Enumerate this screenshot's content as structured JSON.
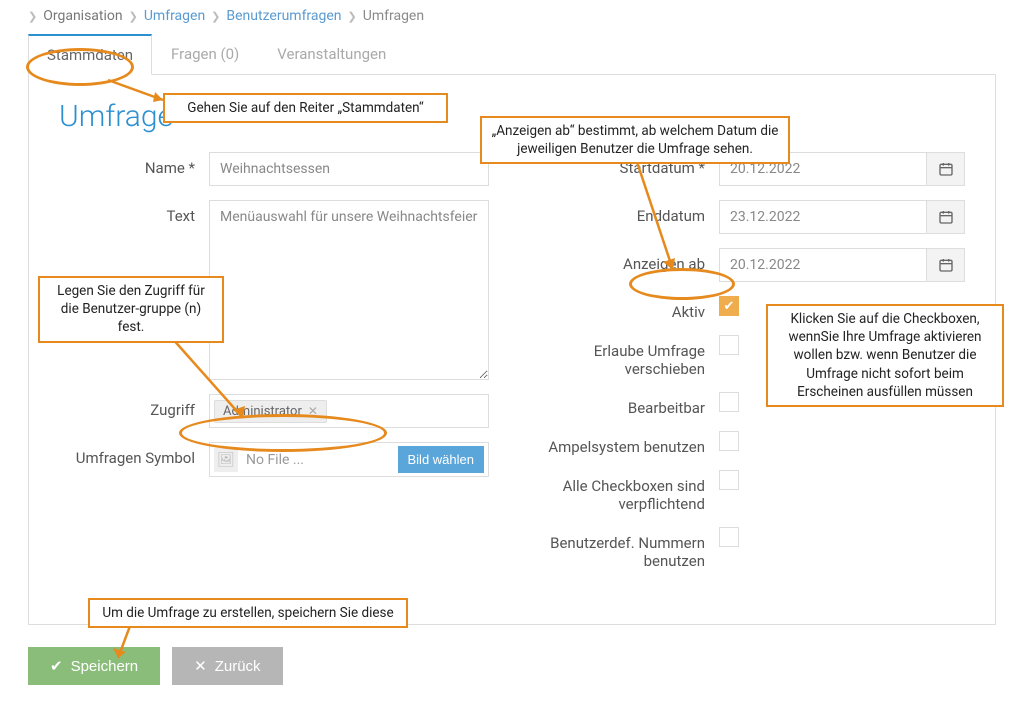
{
  "breadcrumb": {
    "item0": "Organisation",
    "item1": "Umfragen",
    "item2": "Benutzerumfragen",
    "item3": "Umfragen"
  },
  "tabs": {
    "t0": "Stammdaten",
    "t1": "Fragen (0)",
    "t2": "Veranstaltungen"
  },
  "title": "Umfrage",
  "left": {
    "name_label": "Name *",
    "name_value": "Weihnachtsessen",
    "text_label": "Text",
    "text_value": "Menüauswahl für unsere Weihnachtsfeier",
    "zugriff_label": "Zugriff",
    "zugriff_tag": "Administrator",
    "symbol_label": "Umfragen Symbol",
    "nofile": "No File ...",
    "choose": "Bild wählen"
  },
  "right": {
    "startdatum_label": "Startdatum *",
    "startdatum_value": "20.12.2022",
    "enddatum_label": "Enddatum",
    "enddatum_value": "23.12.2022",
    "anzeigen_label": "Anzeigen ab",
    "anzeigen_value": "20.12.2022",
    "aktiv_label": "Aktiv",
    "verschieben_label": "Erlaube Umfrage verschieben",
    "bearbeitbar_label": "Bearbeitbar",
    "ampel_label": "Ampelsystem benutzen",
    "allecb_label": "Alle Checkboxen sind verpflichtend",
    "nummern_label": "Benutzerdef. Nummern benutzen"
  },
  "buttons": {
    "save": "Speichern",
    "back": "Zurück"
  },
  "callouts": {
    "c_tab": "Gehen Sie auf den Reiter „Stammdaten“",
    "c_anzeigen": "„Anzeigen ab“ bestimmt, ab welchem Datum die jeweiligen Benutzer die Umfrage sehen.",
    "c_zugriff": "Legen Sie den Zugriff für die Benutzer-gruppe (n) fest.",
    "c_aktiv": "Klicken Sie auf die Checkboxen, wennSie Ihre Umfrage aktivieren wollen bzw. wenn Benutzer die Umfrage nicht sofort beim Erscheinen ausfüllen müssen",
    "c_save": "Um die Umfrage zu erstellen, speichern Sie diese"
  }
}
